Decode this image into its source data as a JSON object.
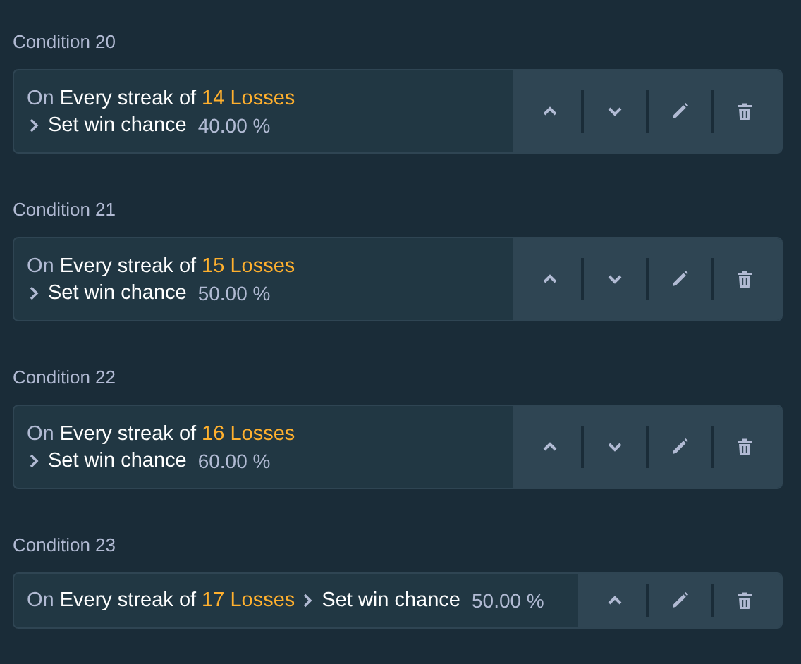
{
  "conditions": [
    {
      "title": "Condition 20",
      "kind": "stacked",
      "prefix": "On",
      "trigger": "Every streak of",
      "count": "14 Losses",
      "action": "Set win chance",
      "value": "40.00 %",
      "actions": [
        {
          "kind": "up"
        },
        {
          "kind": "down"
        },
        {
          "kind": "edit"
        },
        {
          "kind": "delete"
        }
      ]
    },
    {
      "title": "Condition 21",
      "kind": "stacked",
      "prefix": "On",
      "trigger": "Every streak of",
      "count": "15 Losses",
      "action": "Set win chance",
      "value": "50.00 %",
      "actions": [
        {
          "kind": "up"
        },
        {
          "kind": "down"
        },
        {
          "kind": "edit"
        },
        {
          "kind": "delete"
        }
      ]
    },
    {
      "title": "Condition 22",
      "kind": "stacked",
      "prefix": "On",
      "trigger": "Every streak of",
      "count": "16 Losses",
      "action": "Set win chance",
      "value": "60.00 %",
      "actions": [
        {
          "kind": "up"
        },
        {
          "kind": "down"
        },
        {
          "kind": "edit"
        },
        {
          "kind": "delete"
        }
      ]
    },
    {
      "title": "Condition 23",
      "kind": "inline",
      "prefix": "On",
      "trigger": "Every streak of",
      "count": "17 Losses",
      "action": "Set win chance",
      "value": "50.00 %",
      "actions": [
        {
          "kind": "up"
        },
        {
          "kind": "edit"
        },
        {
          "kind": "delete"
        }
      ]
    }
  ]
}
